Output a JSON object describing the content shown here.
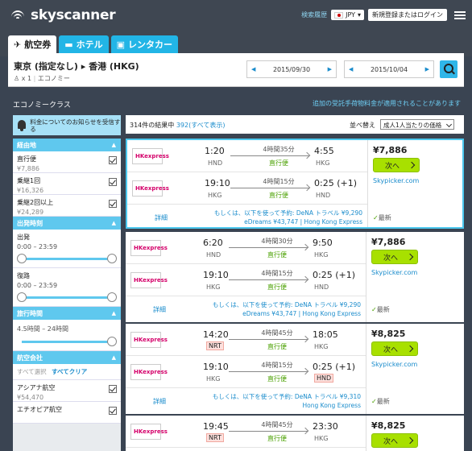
{
  "header": {
    "brand": "skyscanner",
    "history_link": "検索履歴",
    "currency": "JPY",
    "login": "新規登録またはログイン",
    "tabs": [
      {
        "label": "航空券",
        "icon": "plane-icon"
      },
      {
        "label": "ホテル",
        "icon": "bed-icon"
      },
      {
        "label": "レンタカー",
        "icon": "car-icon"
      }
    ]
  },
  "search": {
    "route": "東京 (指定なし) ▸ 香港 (HKG)",
    "passengers": "x 1",
    "cabin": "エコノミー",
    "depart_date": "2015/09/30",
    "return_date": "2015/10/04"
  },
  "strip": {
    "cabin_class": "エコノミークラス",
    "baggage_notice": "追加の受託手荷物料金が適用されることがあります"
  },
  "sidebar": {
    "alert": "料金についてのお知らせを受信する",
    "stops_title": "経由地",
    "stops": [
      {
        "label": "直行便",
        "price": "¥7,886"
      },
      {
        "label": "乗継1回",
        "price": "¥16,326"
      },
      {
        "label": "乗継2回以上",
        "price": "¥24,289"
      }
    ],
    "times_title": "出発時刻",
    "outbound_label": "出発",
    "outbound_range": "0:00 – 23:59",
    "return_label": "復路",
    "return_range": "0:00 – 23:59",
    "duration_title": "旅行時間",
    "duration_range": "4.5時間 – 24時間",
    "airlines_title": "航空会社",
    "select_all": "すべて選択",
    "clear_all": "すべてクリア",
    "airlines": [
      {
        "label": "アシアナ航空",
        "price": "¥54,470"
      },
      {
        "label": "エチオピア航空",
        "price": ""
      }
    ]
  },
  "results": {
    "count_text": "314件の結果中",
    "shown_link": "392(すべて表示)",
    "sort_label": "並べ替え",
    "sort_value": "成人1人当たりの価格"
  },
  "cards": [
    {
      "legs": [
        {
          "dep": "1:20",
          "from": "HND",
          "dur": "4時間35分",
          "type": "直行便",
          "arr": "4:55",
          "to": "HKG"
        },
        {
          "dep": "19:10",
          "from": "HKG",
          "dur": "4時間15分",
          "type": "直行便",
          "arr": "0:25 (+1)",
          "to": "HND"
        }
      ],
      "detail": "詳細",
      "also_line1": "もしくは、以下を使って予約: DeNA トラベル ¥9,290",
      "also_line2": "eDreams ¥43,747 | Hong Kong Express",
      "price": "¥7,886",
      "book": "次へ",
      "site": "Skypicker.com",
      "latest": "最新"
    },
    {
      "legs": [
        {
          "dep": "6:20",
          "from": "HND",
          "dur": "4時間30分",
          "type": "直行便",
          "arr": "9:50",
          "to": "HKG"
        },
        {
          "dep": "19:10",
          "from": "HKG",
          "dur": "4時間15分",
          "type": "直行便",
          "arr": "0:25 (+1)",
          "to": "HND"
        }
      ],
      "detail": "詳細",
      "also_line1": "もしくは、以下を使って予約: DeNA トラベル ¥9,290",
      "also_line2": "eDreams ¥43,747 | Hong Kong Express",
      "price": "¥7,886",
      "book": "次へ",
      "site": "Skypicker.com",
      "latest": "最新"
    },
    {
      "legs": [
        {
          "dep": "14:20",
          "from": "NRT",
          "dur": "4時間45分",
          "type": "直行便",
          "arr": "18:05",
          "to": "HKG"
        },
        {
          "dep": "19:10",
          "from": "HKG",
          "dur": "4時間15分",
          "type": "直行便",
          "arr": "0:25 (+1)",
          "to": "HND"
        }
      ],
      "detail": "詳細",
      "also_line1": "もしくは、以下を使って予約: DeNA トラベル ¥9,310",
      "also_line2": "Hong Kong Express",
      "price": "¥8,825",
      "book": "次へ",
      "site": "Skypicker.com",
      "latest": "最新"
    },
    {
      "legs": [
        {
          "dep": "19:45",
          "from": "NRT",
          "dur": "4時間45分",
          "type": "直行便",
          "arr": "23:30",
          "to": "HKG"
        }
      ],
      "price": "¥8,825",
      "book": "次へ"
    }
  ],
  "airline_logo_text": "HKexpress"
}
